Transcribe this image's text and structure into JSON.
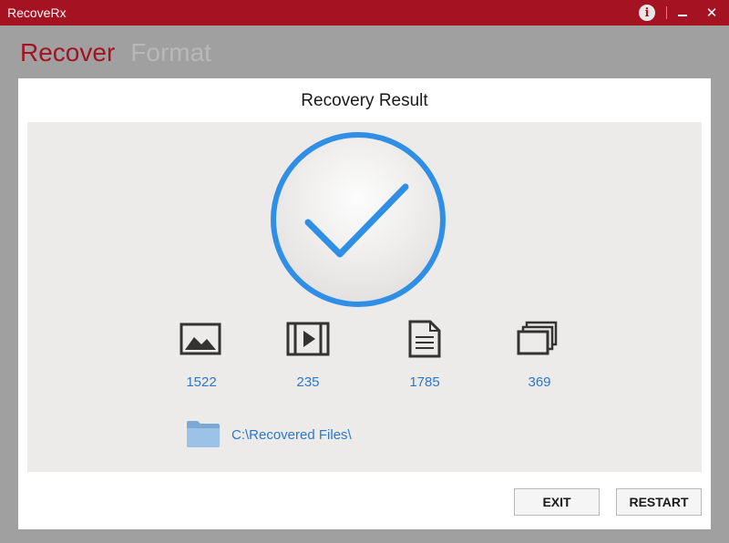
{
  "window": {
    "title": "RecoveRx",
    "info_glyph": "i",
    "close_glyph": "✕"
  },
  "tabs": [
    {
      "label": "Recover",
      "active": true
    },
    {
      "label": "Format",
      "active": false
    }
  ],
  "panel": {
    "title": "Recovery Result"
  },
  "stats": [
    {
      "icon": "image-icon",
      "value": "1522"
    },
    {
      "icon": "video-icon",
      "value": "235"
    },
    {
      "icon": "document-icon",
      "value": "1785"
    },
    {
      "icon": "other-files-icon",
      "value": "369"
    }
  ],
  "folder": {
    "icon": "folder-icon",
    "path": "C:\\Recovered Files\\"
  },
  "buttons": {
    "exit": "EXIT",
    "restart": "RESTART"
  },
  "colors": {
    "brand": "#a51222",
    "accent_blue": "#2b78c8",
    "check_blue": "#2f8ee6"
  }
}
